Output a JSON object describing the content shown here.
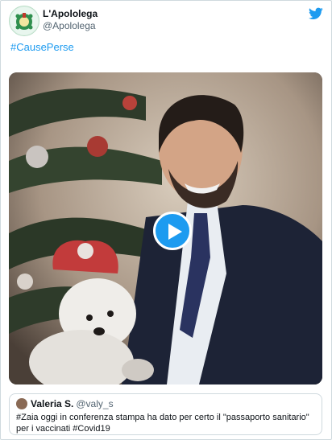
{
  "account": {
    "display_name": "L'Apololega",
    "handle": "@Apololega"
  },
  "tweet": {
    "text": "#CausePerse"
  },
  "video": {
    "play_icon": "play-icon"
  },
  "quoted_tweet": {
    "display_name": "Valeria S.",
    "handle": "@valy_s",
    "text": "#Zaia oggi in conferenza stampa ha dato per certo il \"passaporto sanitario\" per i vaccinati #Covid19"
  },
  "colors": {
    "link": "#1d9bf0",
    "twitter_blue": "#1d9bf0",
    "border": "#cfd9de",
    "secondary_text": "#536471"
  }
}
